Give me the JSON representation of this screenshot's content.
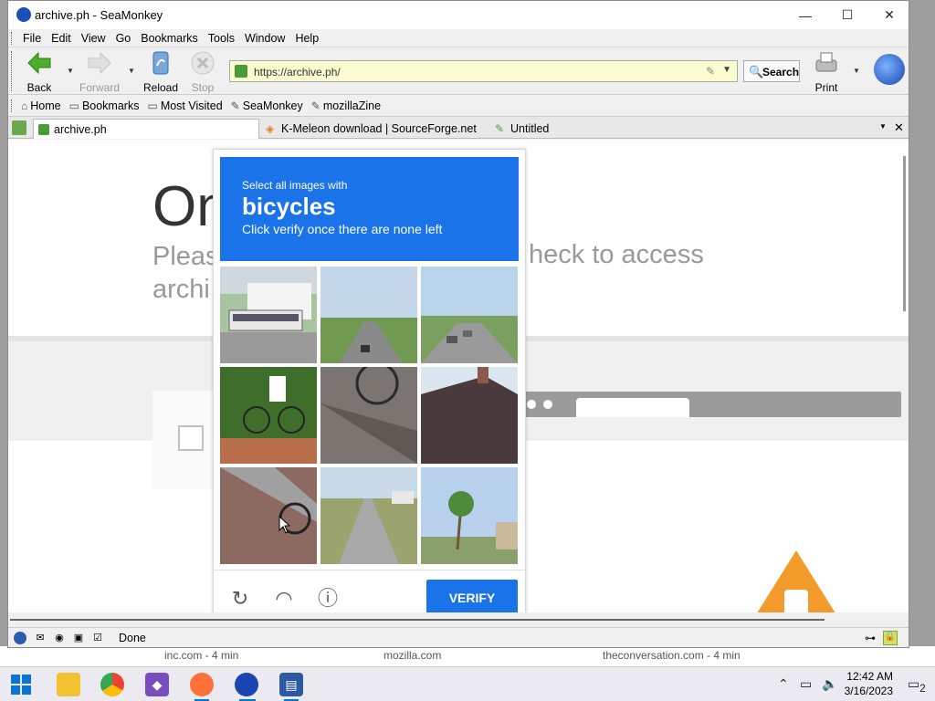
{
  "window": {
    "title": "archive.ph - SeaMonkey",
    "minimize": "—",
    "maximize": "☐",
    "close": "✕"
  },
  "menu": [
    "File",
    "Edit",
    "View",
    "Go",
    "Bookmarks",
    "Tools",
    "Window",
    "Help"
  ],
  "nav": {
    "back": "Back",
    "forward": "Forward",
    "reload": "Reload",
    "stop": "Stop",
    "url": "https://archive.ph/",
    "search": "Search",
    "print": "Print"
  },
  "bookmarks": [
    "Home",
    "Bookmarks",
    "Most Visited",
    "SeaMonkey",
    "mozillaZine"
  ],
  "tabs": [
    {
      "label": "archive.ph",
      "active": true
    },
    {
      "label": "K-Meleon download | SourceForge.net",
      "active": false
    },
    {
      "label": "Untitled",
      "active": false
    }
  ],
  "page": {
    "heading": "On",
    "sub_line1": "Pleas",
    "sub_line2": "archi",
    "sub_right": "heck to access"
  },
  "captcha": {
    "instruction": "Select all images with",
    "target": "bicycles",
    "hint": "Click verify once there are none left",
    "verify": "VERIFY",
    "tiles": [
      "bus-at-intersection",
      "road-with-traffic-lights",
      "street-with-cars",
      "cyclist-on-grass",
      "bicycle-wheel-shadow",
      "house-roof",
      "bicycle-on-brick-sidewalk",
      "empty-road-with-truck",
      "palm-trees-street"
    ]
  },
  "status": {
    "text": "Done"
  },
  "desktop_strip": [
    "inc.com - 4 min",
    "mozilla.com",
    "theconversation.com - 4 min"
  ],
  "taskbar": {
    "time": "12:42 AM",
    "date": "3/16/2023",
    "notif_count": "2"
  },
  "colors": {
    "captcha_blue": "#1a73e8",
    "url_bg": "#fbfbd0",
    "cone": "#f39c2b"
  }
}
